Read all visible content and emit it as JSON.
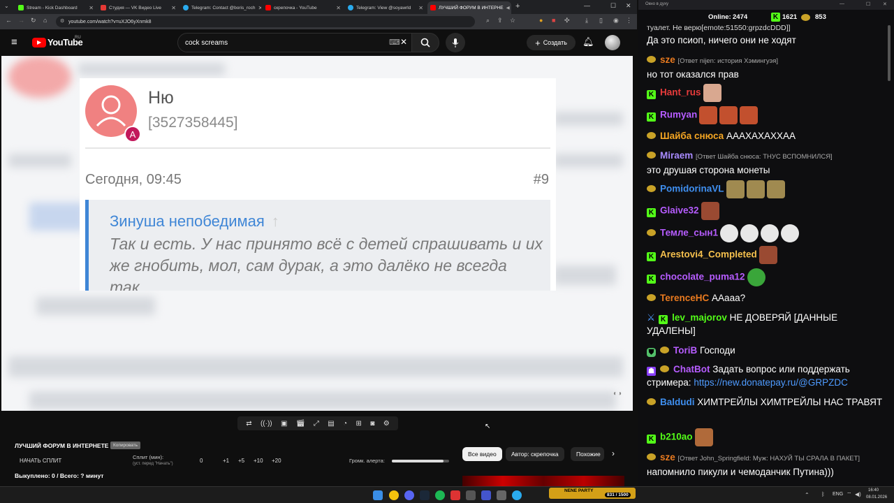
{
  "browser": {
    "tabs": [
      {
        "label": "Stream - Kick Dashboard",
        "color": "#53fc18"
      },
      {
        "label": "Студия — VK Видео Live",
        "color": "#e53935"
      },
      {
        "label": "Telegram: Contact @boris_roch",
        "color": "#2aabee"
      },
      {
        "label": "скрепочка - YouTube",
        "color": "#ff0000"
      },
      {
        "label": "Telegram: View @soyawrld",
        "color": "#2aabee"
      },
      {
        "label": "ЛУЧШИЙ ФОРУМ В ИНТЕРНЕ",
        "color": "#ff0000"
      }
    ],
    "new_tab": "+",
    "url": "youtube.com/watch?v=uXJO6yXnmk8"
  },
  "youtube": {
    "logo": "YouTube",
    "logo_region": "RU",
    "search_value": "cock screams",
    "create_label": "Создать"
  },
  "video": {
    "user_name": "Ню",
    "user_id": "[3527358445]",
    "avatar_badge": "A",
    "post_date": "Сегодня, 09:45",
    "post_number": "#9",
    "quote_author": "Зинуша непобедимая",
    "quote_text": "Так и есть. У нас принято всё с детей спрашивать и их же гнобить, мол, сам дурак, а это далёко не всегда так."
  },
  "stream_panel": {
    "title": "ЛУЧШИЙ ФОРУМ В ИНТЕРНЕТЕ",
    "copy_label": "Копировать",
    "start_split": "НАЧАТЬ СПЛИТ",
    "split_label": "Сплит (мин):",
    "split_hint": "(уст. перед \"Начать\")",
    "split_value": "0",
    "increments": [
      "+1",
      "+5",
      "+10",
      "+20"
    ],
    "alert_volume_label": "Громк. алерта:",
    "alert_volume": 0.9,
    "bought_line": "Выкуплено: 0 / Всего: ? минут",
    "chips": [
      "Все видео",
      "Автор: скрепочка",
      "Похожие"
    ]
  },
  "chat": {
    "window_title": "Окно в духу",
    "online_label": "Online:",
    "online_count": "2474",
    "kick_count": "1621",
    "coin_count": "853",
    "messages": [
      {
        "text": "туалет. Не верю[emote:51550:grpzdcDDD]]"
      },
      {
        "text": "Да это псиоп, ничего они не ходят"
      },
      {
        "nick": "sze",
        "color": "#e97a1f",
        "reply": "[Ответ nijen: история Хэмингуэя]",
        "text": "но тот оказался прав"
      },
      {
        "nick": "Hant_rus",
        "color": "#e83b3b"
      },
      {
        "nick": "Rumyan",
        "color": "#b65cff"
      },
      {
        "nick": "Шайба снюса",
        "color": "#f5a623",
        "text": "АААХАХАХХАА"
      },
      {
        "nick": "Miraem",
        "color": "#a98bff",
        "reply": "[Ответ Шайба снюса: ТНУС ВСПОМНИЛСЯ]",
        "text": "это друшая сторона монеты"
      },
      {
        "nick": "PomidorinaVL",
        "color": "#3f8ff0"
      },
      {
        "nick": "Glaive32",
        "color": "#b65cff"
      },
      {
        "nick": "Темле_сын1",
        "color": "#b65cff"
      },
      {
        "nick": "Arestovi4_Completed",
        "color": "#f5c04d"
      },
      {
        "nick": "chocolate_puma12",
        "color": "#b65cff"
      },
      {
        "nick": "TerenceHC",
        "color": "#e97a1f",
        "text": "АAааа?"
      },
      {
        "nick": "lev_majorov",
        "color": "#53fc18",
        "text": "НЕ ДОВЕРЯЙ [ДАННЫЕ УДАЛЕНЫ]"
      },
      {
        "nick": "ToriB",
        "color": "#b65cff",
        "text": "Господи"
      },
      {
        "nick": "ChatBot",
        "color": "#b65cff",
        "text": "Задать вопрос или поддержать стримера:",
        "link": "https://new.donatepay.ru/@GRPZDC"
      },
      {
        "nick": "Baldudi",
        "color": "#3f8ff0",
        "text": "ХИМТРЕЙЛЫ ХИМТРЕЙЛЫ НАС ТРАВЯТ"
      },
      {
        "nick": "b210ao",
        "color": "#53fc18"
      },
      {
        "nick": "sze",
        "color": "#e97a1f",
        "reply": "[Ответ John_Springfield: Муж: НАХУЙ ТЫ СРАЛА В ПАКЕТ]",
        "text": "напомнило пикули и чемоданчик Путина)))"
      }
    ]
  },
  "taskbar": {
    "lang": "ENG",
    "time": "16:40",
    "date": "08.01.2026",
    "banner": "NENE PARTY",
    "banner_count": "831 / 1500"
  }
}
